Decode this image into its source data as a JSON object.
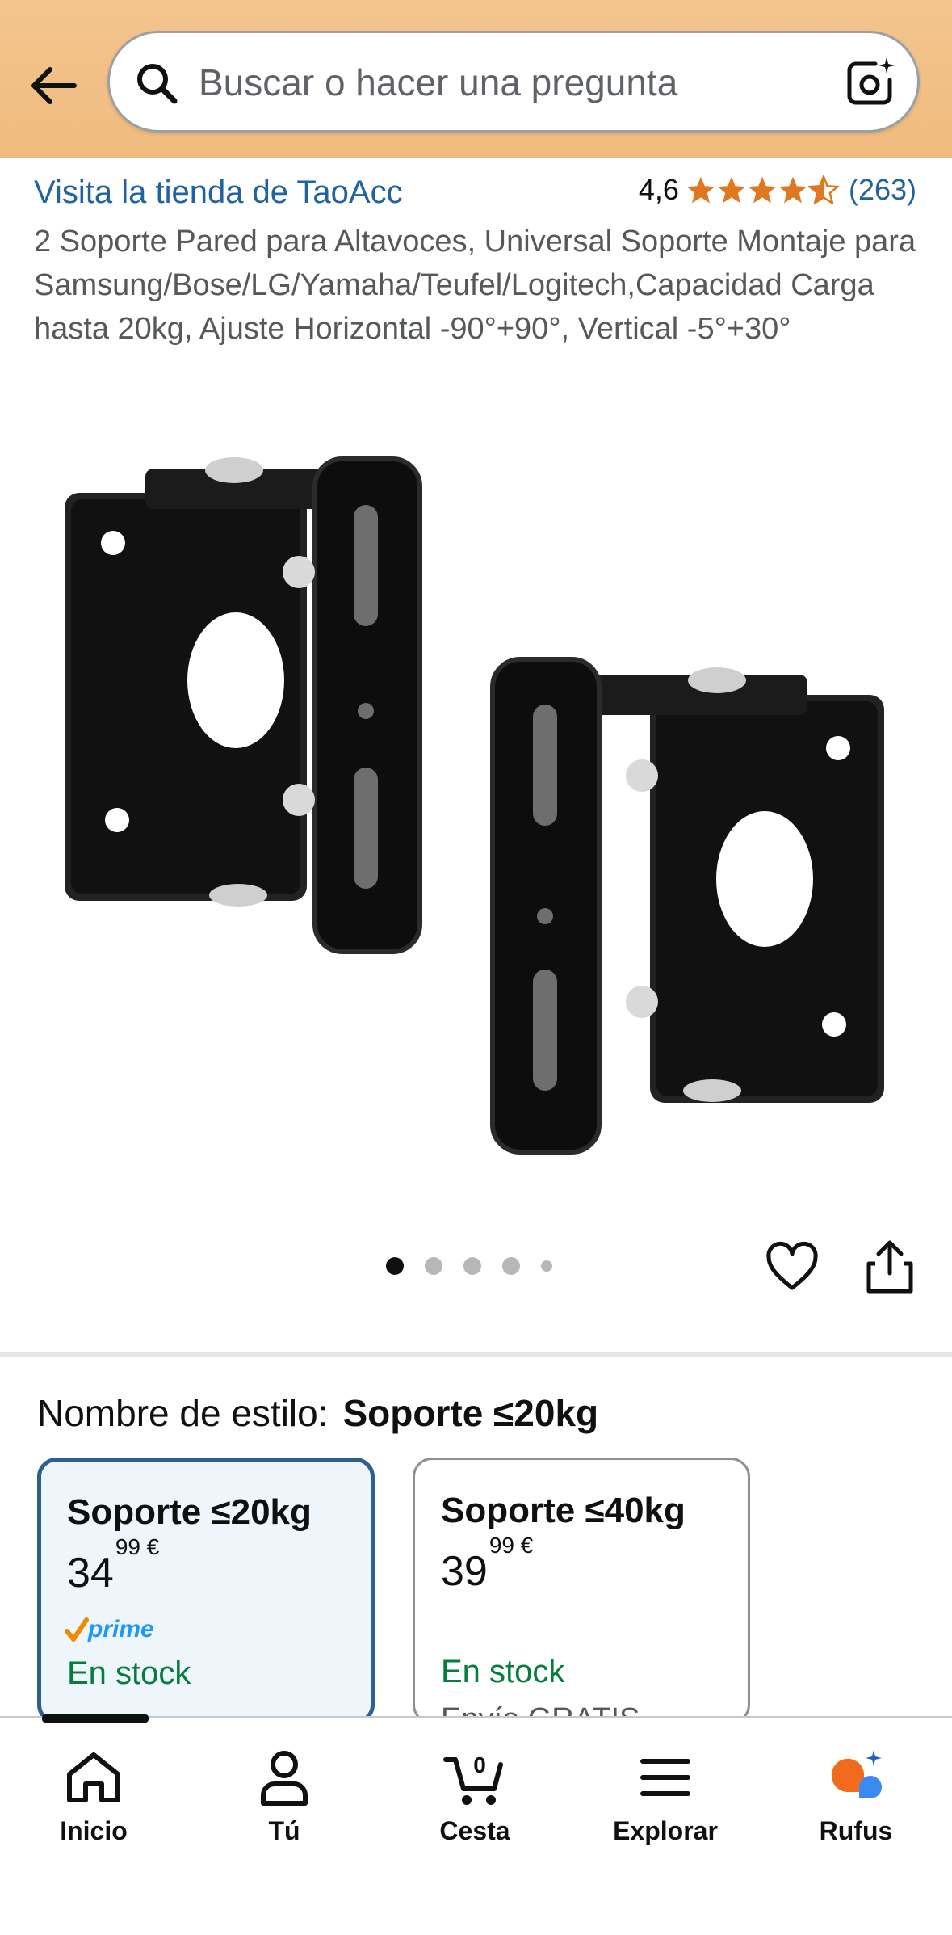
{
  "header": {
    "search_placeholder": "Buscar o hacer una pregunta"
  },
  "product": {
    "store_link": "Visita la tienda de TaoAcc",
    "rating_value": "4,6",
    "rating_stars": 4.6,
    "rating_count": "(263)",
    "title": "2 Soporte Pared para Altavoces, Universal Soporte Montaje para Samsung/Bose/LG/Yamaha/Teufel/Logitech,Capacidad Carga hasta 20kg, Ajuste Horizontal -90°+90°, Vertical -5°+30°",
    "image_count": 5,
    "current_image": 1
  },
  "style": {
    "label": "Nombre de estilo:",
    "selected": "Soporte ≤20kg",
    "options": [
      {
        "name": "Soporte ≤20kg",
        "price_whole": "34",
        "price_fraction": "99",
        "currency": "€",
        "prime": "prime",
        "stock": "En stock",
        "selected": true
      },
      {
        "name": "Soporte ≤40kg",
        "price_whole": "39",
        "price_fraction": "99",
        "currency": "€",
        "stock": "En stock",
        "shipping": "Envío GRATIS",
        "selected": false
      }
    ]
  },
  "tabs": [
    {
      "label": "Inicio",
      "icon": "home-icon"
    },
    {
      "label": "Tú",
      "icon": "user-icon"
    },
    {
      "label": "Cesta",
      "icon": "cart-icon",
      "badge": "0"
    },
    {
      "label": "Explorar",
      "icon": "menu-icon"
    },
    {
      "label": "Rufus",
      "icon": "rufus-icon"
    }
  ],
  "colors": {
    "header_bg": "#f3c58f",
    "link": "#2162a1",
    "star": "#de7921",
    "stock_green": "#067d3e",
    "selected_border": "#2d5f92",
    "prime_blue": "#1a98ff"
  }
}
